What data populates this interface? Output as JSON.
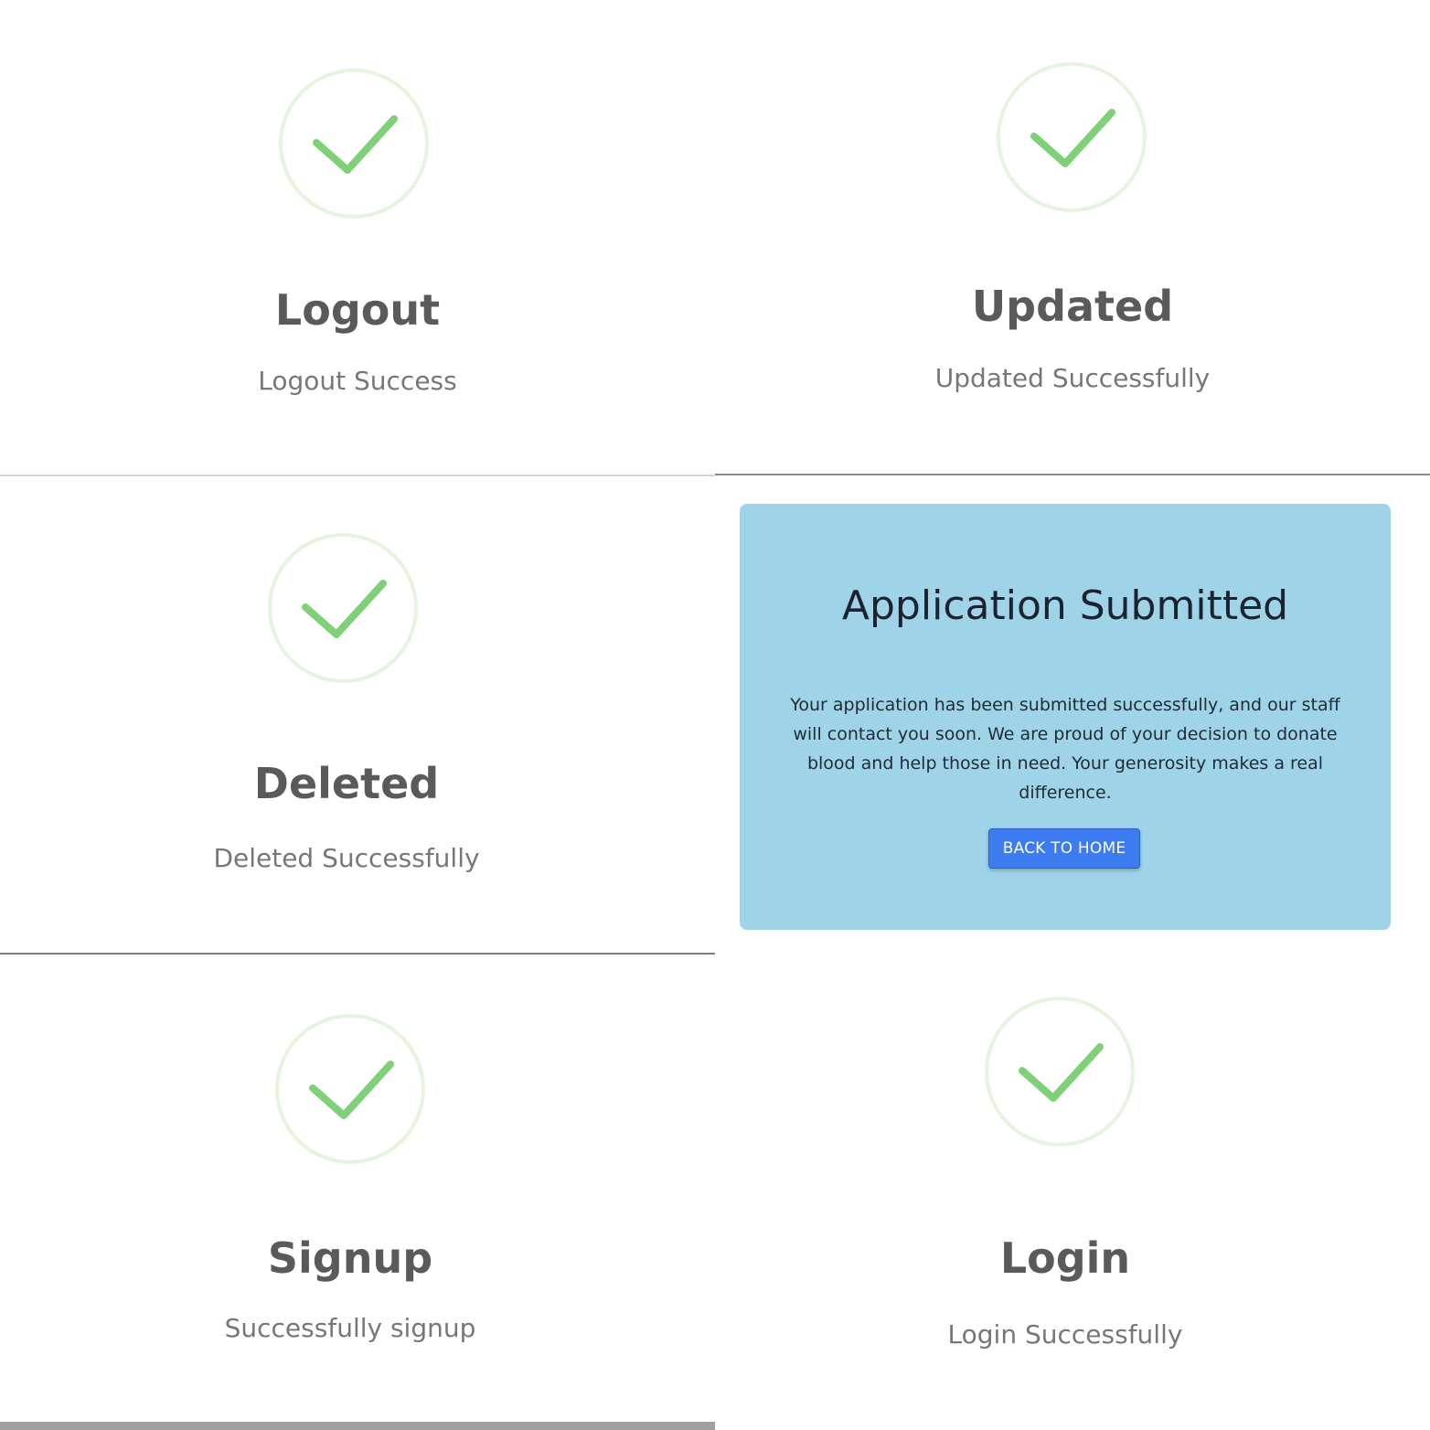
{
  "panels": {
    "logout": {
      "title": "Logout",
      "subtitle": "Logout Success"
    },
    "updated": {
      "title": "Updated",
      "subtitle": "Updated Successfully"
    },
    "deleted": {
      "title": "Deleted",
      "subtitle": "Deleted Successfully"
    },
    "signup": {
      "title": "Signup",
      "subtitle": "Successfully signup"
    },
    "login": {
      "title": "Login",
      "subtitle": "Login Successfully"
    }
  },
  "application": {
    "title": "Application Submitted",
    "message": "Your application has been submitted successfully, and our staff will contact you soon. We are proud of your decision to donate blood and help those in need. Your generosity makes a real difference.",
    "button_label": "BACK TO HOME"
  },
  "icons": {
    "check": "check-icon"
  },
  "colors": {
    "check_green": "#80d07a",
    "card_background": "#9fd4e8",
    "button_blue": "#3d7cf0"
  }
}
